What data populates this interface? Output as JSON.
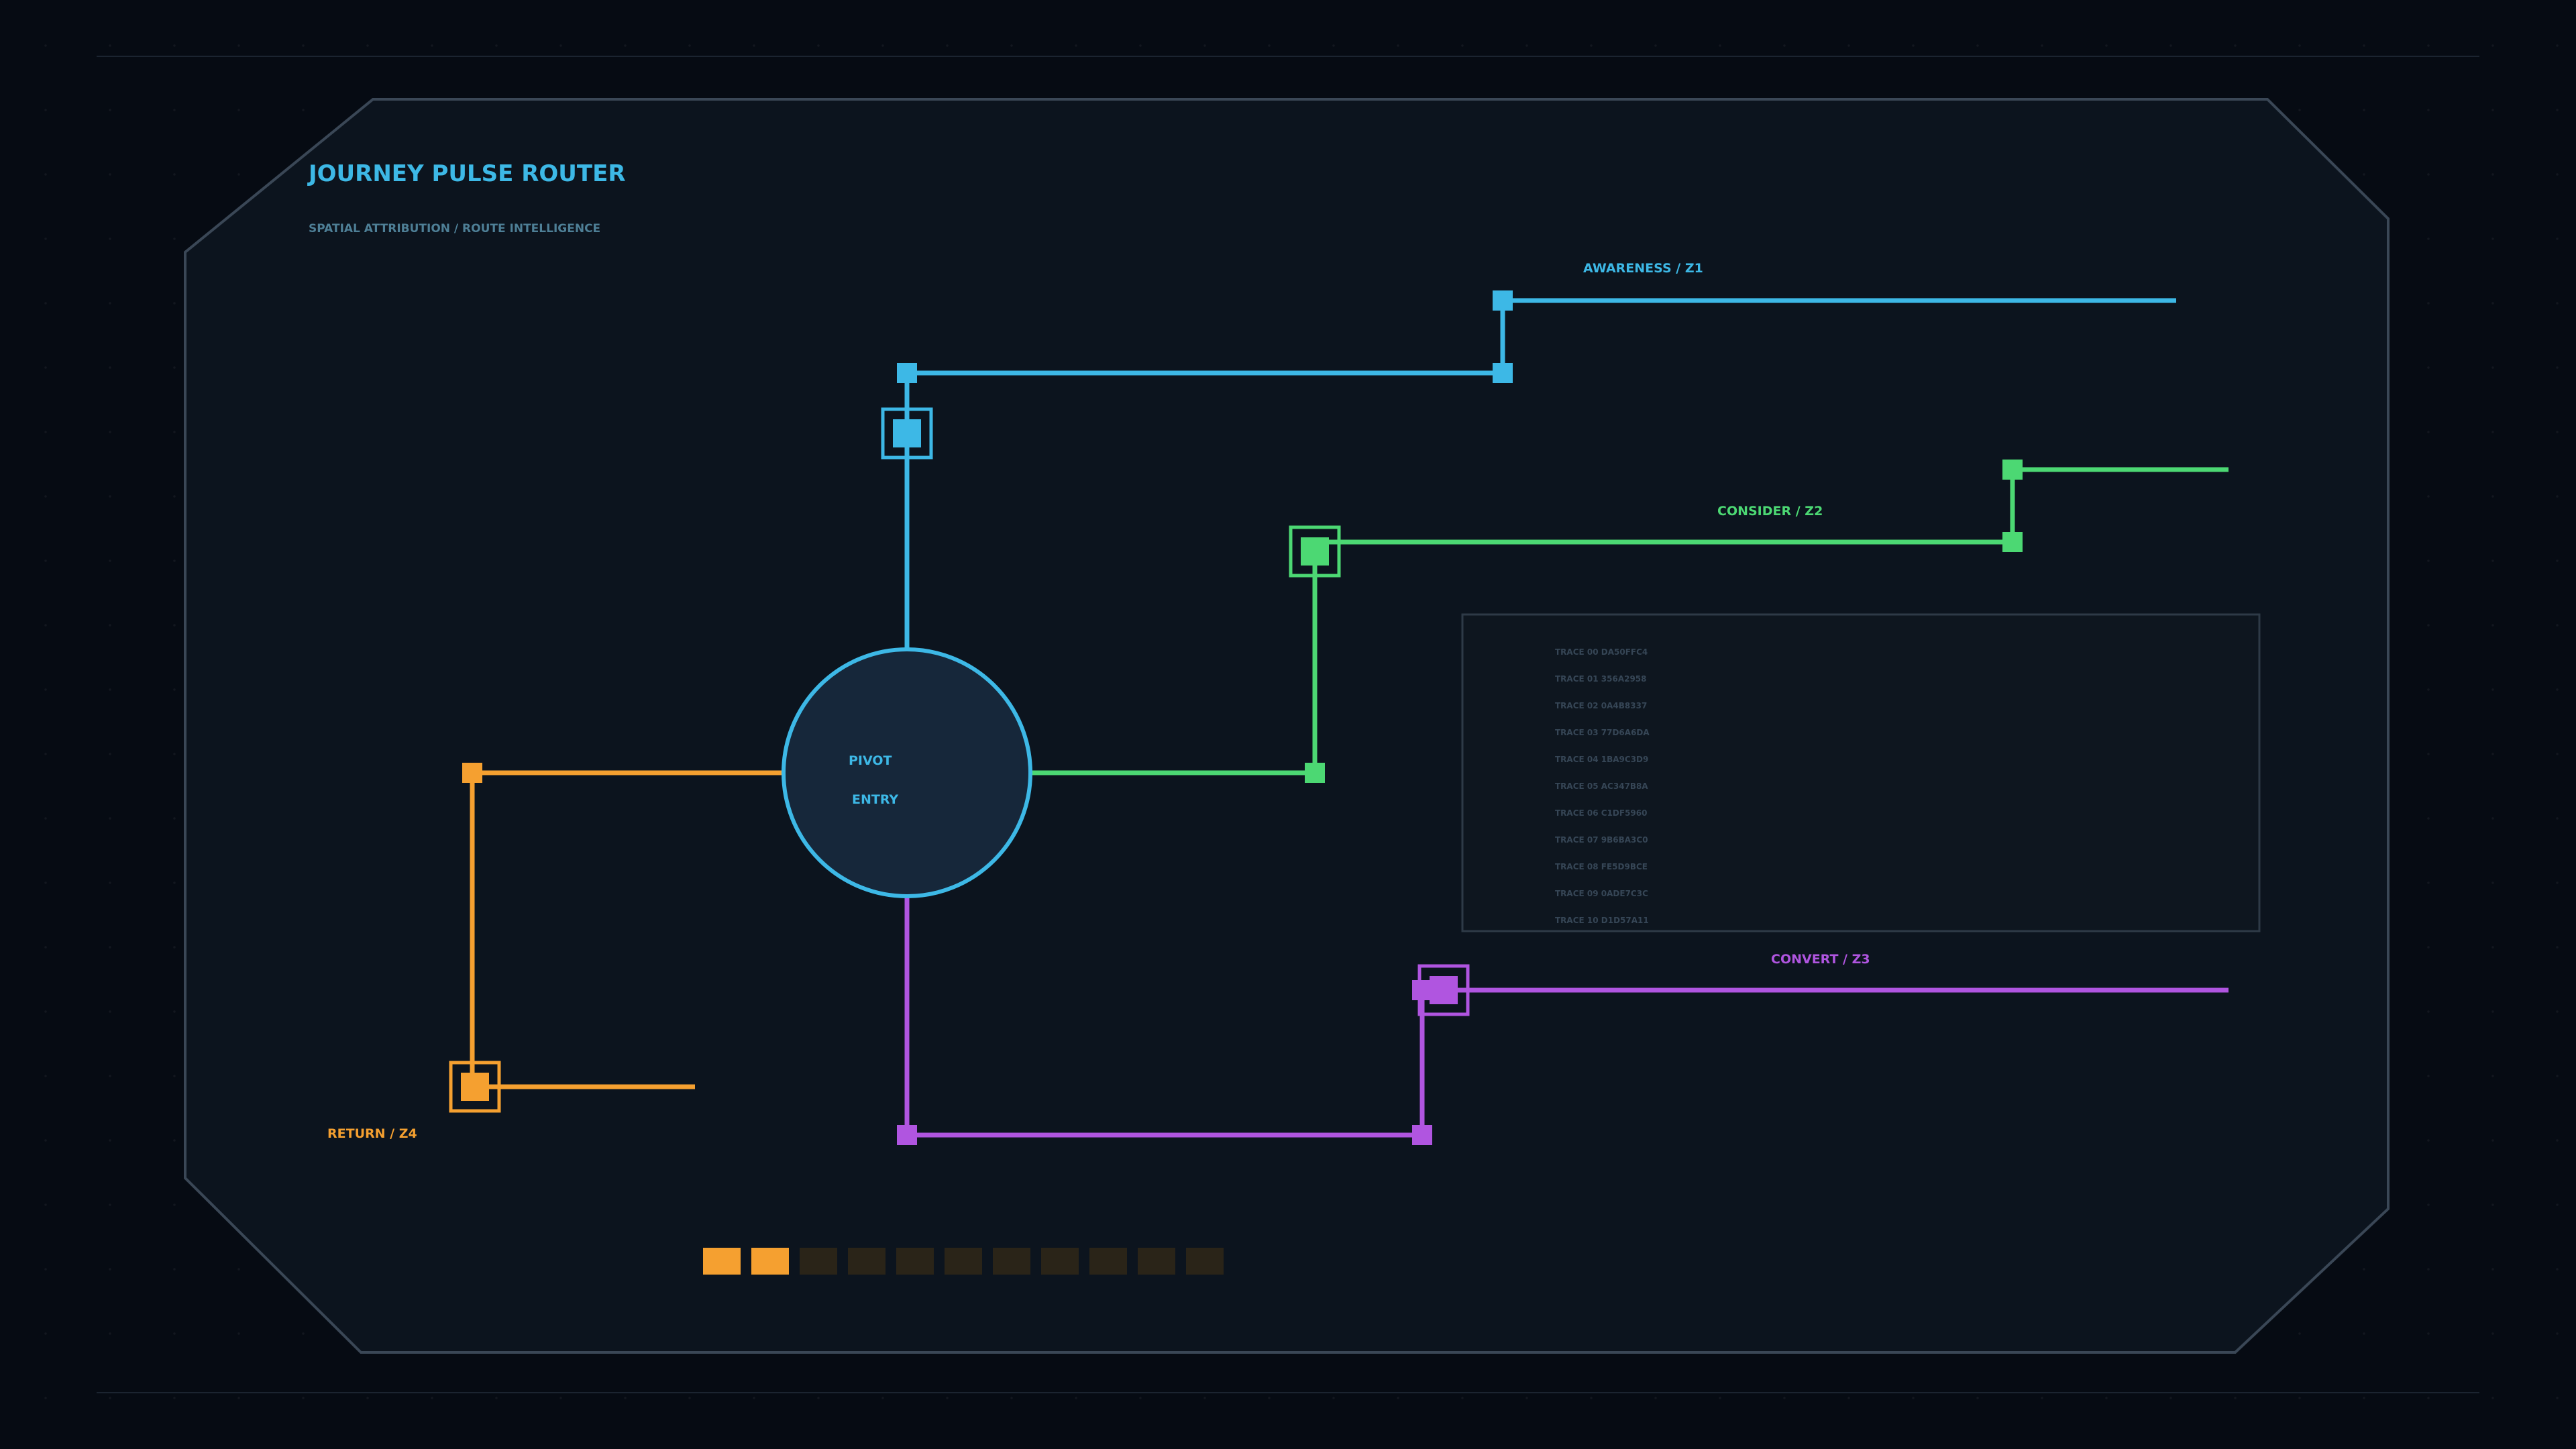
{
  "header": {
    "title": "JOURNEY PULSE ROUTER",
    "subtitle": "SPATIAL ATTRIBUTION / ROUTE INTELLIGENCE"
  },
  "hub": {
    "line1": "PIVOT",
    "line2": "ENTRY"
  },
  "routes": {
    "awareness": "AWARENESS / Z1",
    "consider": "CONSIDER / Z2",
    "convert": "CONVERT / Z3",
    "return": "RETURN / Z4"
  },
  "traces": [
    "TRACE 00 DA50FFC4",
    "TRACE 01 356A2958",
    "TRACE 02 0A4B8337",
    "TRACE 03 77D6A6DA",
    "TRACE 04 1BA9C3D9",
    "TRACE 05 AC347B8A",
    "TRACE 06 C1DF5960",
    "TRACE 07 9B6BA3C0",
    "TRACE 08 FE5D9BCE",
    "TRACE 09 0ADE7C3C",
    "TRACE 10 D1D57A11"
  ],
  "progress": {
    "filled": 2,
    "total": 11
  },
  "colors": {
    "awareness": "#3db8e6",
    "consider": "#4cd873",
    "convert": "#b055e0",
    "return": "#f5a030",
    "frame": "#3a4756",
    "panel": "#0d1520",
    "hub_fill": "#16273a"
  }
}
